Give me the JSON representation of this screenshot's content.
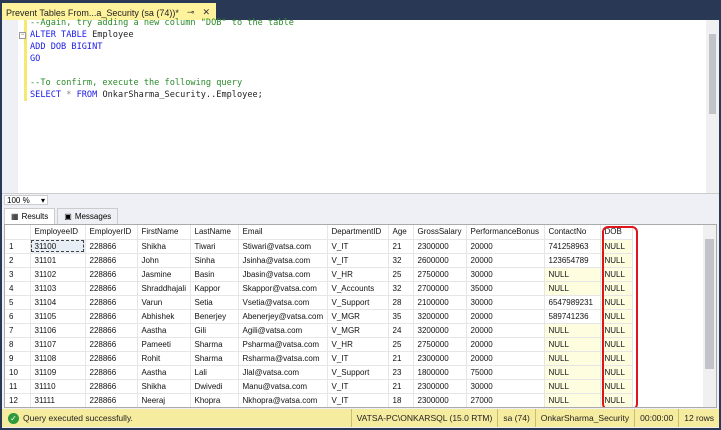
{
  "doc_tab": {
    "title": "Prevent Tables From...a_Security (sa (74))*",
    "pin_icon": "⊸",
    "close_icon": "✕"
  },
  "editor": {
    "lines": [
      "--Again, try adding a new column \"DOB\" to the table",
      "ALTER TABLE",
      " Employee",
      "ADD DOB BIGINT",
      "GO",
      "--To confirm, execute the following query",
      "SELECT",
      " * ",
      "FROM",
      " OnkarSharma_Security..Employee;"
    ]
  },
  "zoom": "100 %",
  "result_tabs": [
    {
      "label": "Results"
    },
    {
      "label": "Messages"
    }
  ],
  "grid": {
    "columns": [
      "",
      "EmployeeID",
      "EmployerID",
      "FirstName",
      "LastName",
      "Email",
      "DepartmentID",
      "Age",
      "GrossSalary",
      "PerformanceBonus",
      "ContactNo",
      "DOB"
    ],
    "rows": [
      [
        "1",
        "31100",
        "228866",
        "Shikha",
        "Tiwari",
        "Stiwari@vatsa.com",
        "V_IT",
        "21",
        "2300000",
        "20000",
        "741258963",
        "NULL"
      ],
      [
        "2",
        "31101",
        "228866",
        "John",
        "Sinha",
        "Jsinha@vatsa.com",
        "V_IT",
        "32",
        "2600000",
        "20000",
        "123654789",
        "NULL"
      ],
      [
        "3",
        "31102",
        "228866",
        "Jasmine",
        "Basin",
        "Jbasin@vatsa.com",
        "V_HR",
        "25",
        "2750000",
        "30000",
        "NULL",
        "NULL"
      ],
      [
        "4",
        "31103",
        "228866",
        "Shraddhajali",
        "Kappor",
        "Skappor@vatsa.com",
        "V_Accounts",
        "32",
        "2700000",
        "35000",
        "NULL",
        "NULL"
      ],
      [
        "5",
        "31104",
        "228866",
        "Varun",
        "Setia",
        "Vsetia@vatsa.com",
        "V_Support",
        "28",
        "2100000",
        "30000",
        "6547989231",
        "NULL"
      ],
      [
        "6",
        "31105",
        "228866",
        "Abhishek",
        "Benerjey",
        "Abenerjey@vatsa.com",
        "V_MGR",
        "35",
        "3200000",
        "20000",
        "589741236",
        "NULL"
      ],
      [
        "7",
        "31106",
        "228866",
        "Aastha",
        "Gili",
        "Agili@vatsa.com",
        "V_MGR",
        "24",
        "3200000",
        "20000",
        "NULL",
        "NULL"
      ],
      [
        "8",
        "31107",
        "228866",
        "Pameeti",
        "Sharma",
        "Psharma@vatsa.com",
        "V_HR",
        "25",
        "2750000",
        "20000",
        "NULL",
        "NULL"
      ],
      [
        "9",
        "31108",
        "228866",
        "Rohit",
        "Sharma",
        "Rsharma@vatsa.com",
        "V_IT",
        "21",
        "2300000",
        "20000",
        "NULL",
        "NULL"
      ],
      [
        "10",
        "31109",
        "228866",
        "Aastha",
        "Lali",
        "Jlal@vatsa.com",
        "V_Support",
        "23",
        "1800000",
        "75000",
        "NULL",
        "NULL"
      ],
      [
        "11",
        "31110",
        "228866",
        "Shikha",
        "Dwivedi",
        "Manu@vatsa.com",
        "V_IT",
        "21",
        "2300000",
        "30000",
        "NULL",
        "NULL"
      ],
      [
        "12",
        "31111",
        "228866",
        "Neeraj",
        "Khopra",
        "Nkhopra@vatsa.com",
        "V_IT",
        "18",
        "2300000",
        "27000",
        "NULL",
        "NULL"
      ]
    ]
  },
  "status": {
    "message": "Query executed successfully.",
    "server": "VATSA-PC\\ONKARSQL (15.0 RTM)",
    "user": "sa (74)",
    "database": "OnkarSharma_Security",
    "elapsed": "00:00:00",
    "rows": "12 rows"
  }
}
